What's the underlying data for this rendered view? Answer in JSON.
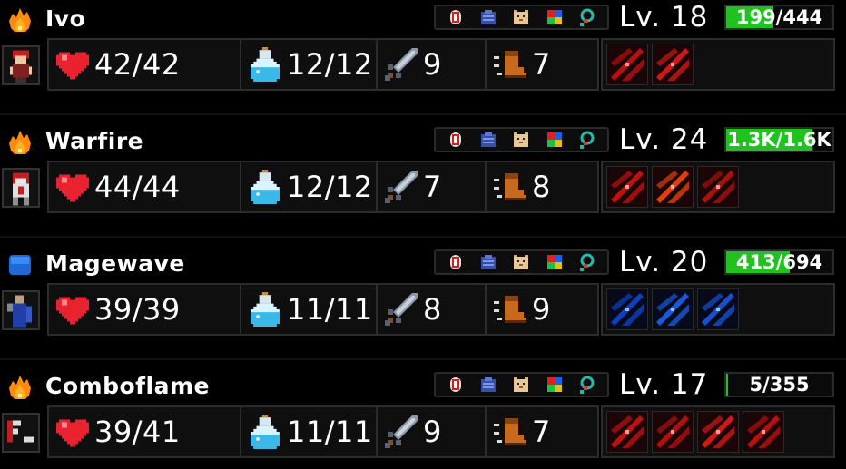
{
  "characters": [
    {
      "name": "Ivo",
      "class_icon": "fire-icon",
      "level": "Lv. 18",
      "xp": {
        "text": "199/444",
        "fraction": 0.448
      },
      "hp": "42/42",
      "mp": "12/12",
      "attack": "9",
      "speed": "7",
      "portrait": "red-haired-warrior",
      "skills": [
        {
          "icon": "crimson-slash-skill-icon",
          "color": "#b81010"
        },
        {
          "icon": "red-shield-skill-icon",
          "color": "#d01818"
        }
      ]
    },
    {
      "name": "Warfire",
      "class_icon": "fire-icon",
      "level": "Lv. 24",
      "xp": {
        "text": "1.3K/1.6K",
        "fraction": 0.81
      },
      "hp": "44/44",
      "mp": "12/12",
      "attack": "7",
      "speed": "8",
      "portrait": "red-armored-knight",
      "skills": [
        {
          "icon": "red-axe-skill-icon",
          "color": "#c01010"
        },
        {
          "icon": "fiery-aura-skill-icon",
          "color": "#e04010"
        },
        {
          "icon": "crossed-swords-skill-icon",
          "color": "#a81010"
        }
      ]
    },
    {
      "name": "Magewave",
      "class_icon": "water-icon",
      "level": "Lv. 20",
      "xp": {
        "text": "413/694",
        "fraction": 0.595
      },
      "hp": "39/39",
      "mp": "11/11",
      "attack": "8",
      "speed": "9",
      "portrait": "blue-robed-mage",
      "skills": [
        {
          "icon": "blue-wave-skill-icon",
          "color": "#1040c0"
        },
        {
          "icon": "blue-pillar-skill-icon",
          "color": "#1a58d8"
        },
        {
          "icon": "blue-burst-skill-icon",
          "color": "#1850d0"
        }
      ]
    },
    {
      "name": "Comboflame",
      "class_icon": "fire-icon",
      "level": "Lv. 17",
      "xp": {
        "text": "5/355",
        "fraction": 0.014
      },
      "hp": "39/41",
      "mp": "11/11",
      "attack": "9",
      "speed": "7",
      "portrait": "masked-fighter",
      "skills": [
        {
          "icon": "red-streaks-skill-icon",
          "color": "#c01010"
        },
        {
          "icon": "red-claw-skill-icon",
          "color": "#b01010"
        },
        {
          "icon": "red-beam-skill-icon",
          "color": "#d01818"
        },
        {
          "icon": "red-strike-skill-icon",
          "color": "#b81010"
        }
      ]
    }
  ],
  "equipment_slots": [
    "helmet-icon",
    "armor-icon",
    "pet-icon",
    "gems-icon",
    "ring-icon"
  ],
  "colors": {
    "xp_fill": "#1fc21f",
    "heart": "#e8232f",
    "potion": "#3ab8e8",
    "sword": "#8c97a8",
    "boot": "#c86a1e",
    "fire": "#ffb020",
    "water": "#1e6ad8"
  }
}
